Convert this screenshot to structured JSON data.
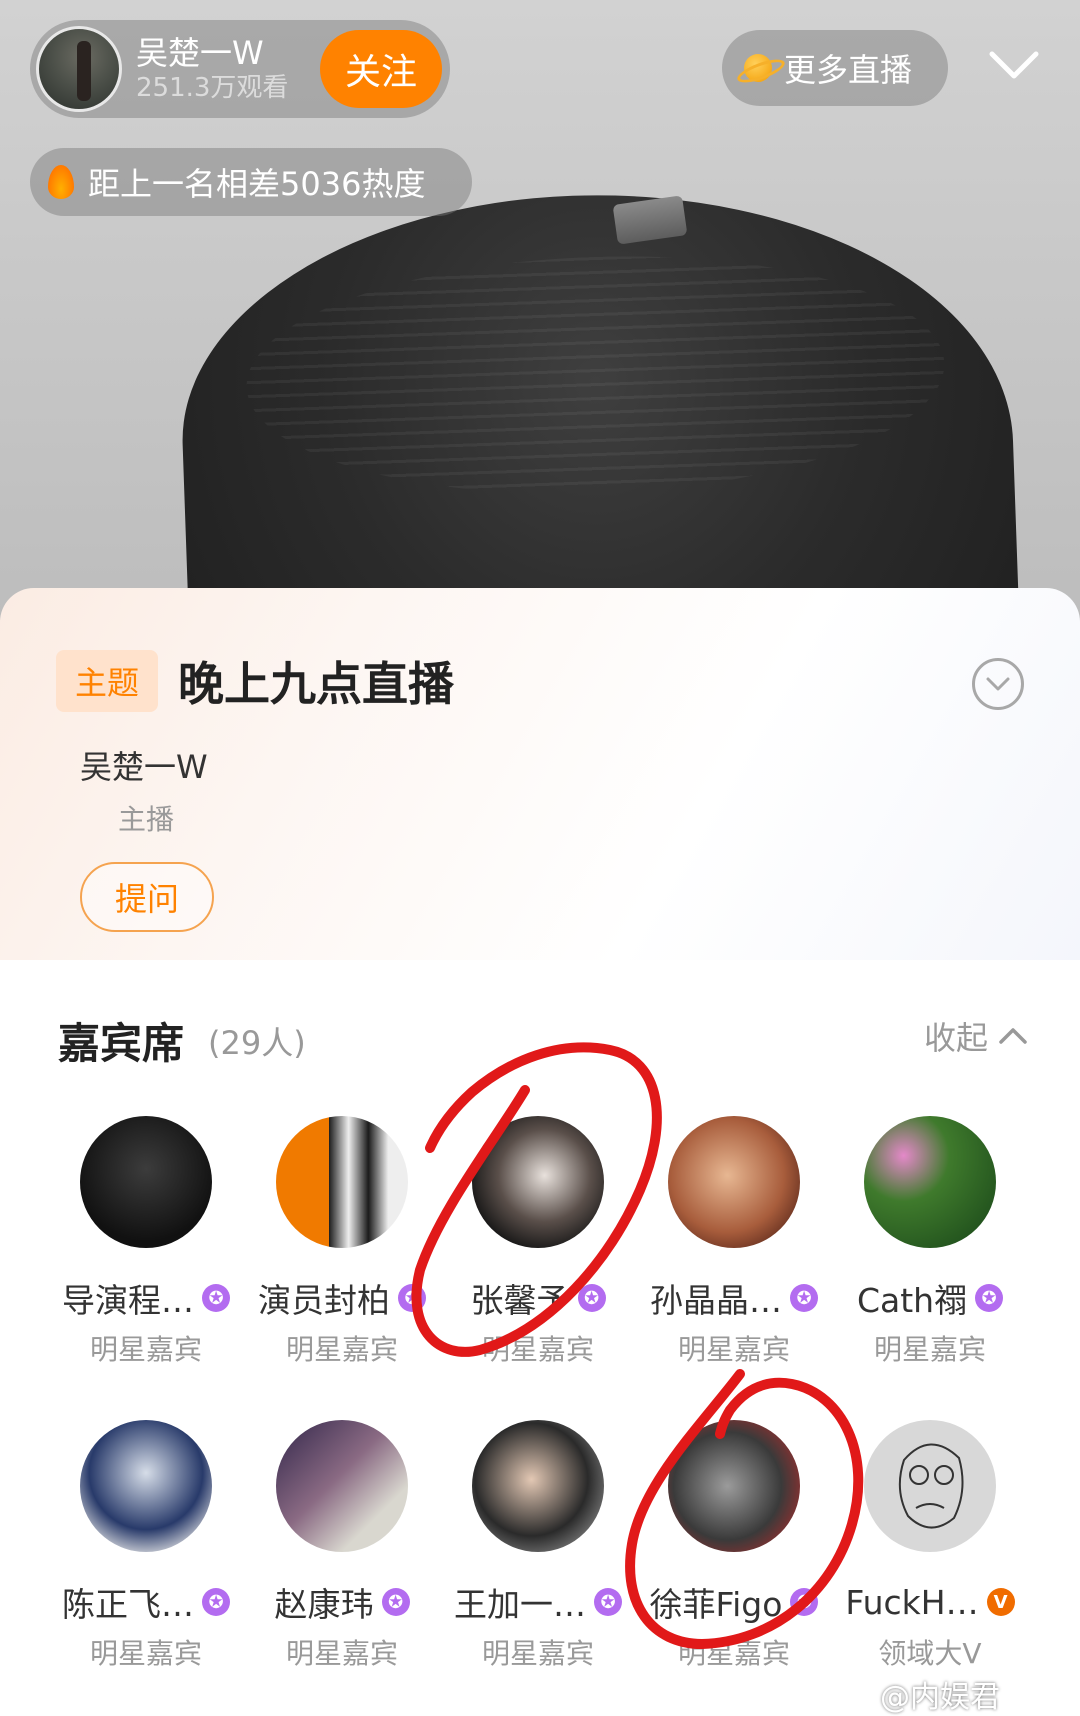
{
  "header": {
    "host_name": "吴楚一W",
    "host_views": "251.3万观看",
    "follow_label": "关注",
    "more_label": "更多直播",
    "heat_text": "距上一名相差5036热度"
  },
  "topic": {
    "tag": "主题",
    "title": "晚上九点直播",
    "anchor_name": "吴楚一W",
    "anchor_role": "主播",
    "ask_label": "提问"
  },
  "guests_section": {
    "title": "嘉宾席",
    "count": "(29人)",
    "fold_label": "收起"
  },
  "guests": [
    {
      "name": "导演程…",
      "role": "明星嘉宾",
      "badge": "star"
    },
    {
      "name": "演员封柏",
      "role": "明星嘉宾",
      "badge": "star"
    },
    {
      "name": "张馨予",
      "role": "明星嘉宾",
      "badge": "star"
    },
    {
      "name": "孙晶晶…",
      "role": "明星嘉宾",
      "badge": "star"
    },
    {
      "name": "Cath禤",
      "role": "明星嘉宾",
      "badge": "star"
    },
    {
      "name": "陈正飞…",
      "role": "明星嘉宾",
      "badge": "star"
    },
    {
      "name": "赵康玮",
      "role": "明星嘉宾",
      "badge": "star"
    },
    {
      "name": "王加一…",
      "role": "明星嘉宾",
      "badge": "star"
    },
    {
      "name": "徐菲Figo",
      "role": "明星嘉宾",
      "badge": "star"
    },
    {
      "name": "FuckH…",
      "role": "领域大V",
      "badge": "V"
    }
  ],
  "watermark": "@内娱君",
  "colors": {
    "accent": "#ff8200",
    "badge_purple": "#b36cf0",
    "marker_red": "#e11919"
  }
}
